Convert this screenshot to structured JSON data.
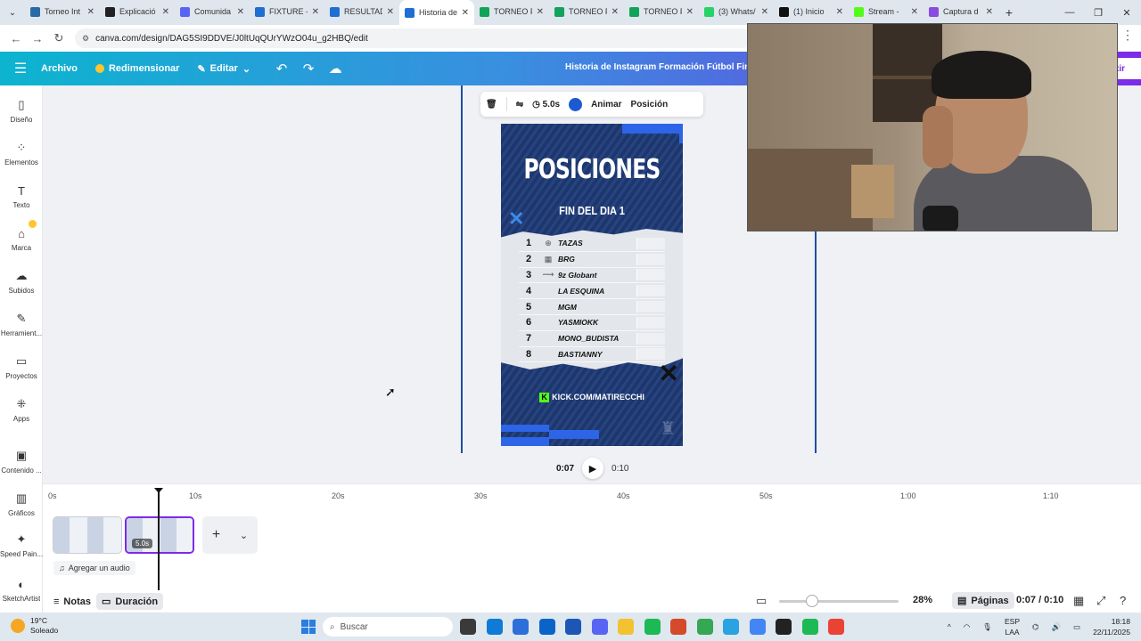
{
  "browser": {
    "tabs": [
      {
        "title": "Torneo Int",
        "color": "#2b6aa8"
      },
      {
        "title": "Explicació",
        "color": "#222"
      },
      {
        "title": "Comunida",
        "color": "#5865f2"
      },
      {
        "title": "FIXTURE -",
        "color": "#1f6fd1"
      },
      {
        "title": "RESULTAD",
        "color": "#1f6fd1"
      },
      {
        "title": "Historia de",
        "color": "#1f6fd1",
        "active": true
      },
      {
        "title": "TORNEO F",
        "color": "#12a35a"
      },
      {
        "title": "TORNEO F",
        "color": "#12a35a"
      },
      {
        "title": "TORNEO F",
        "color": "#12a35a"
      },
      {
        "title": "(3) Whats/",
        "color": "#25d366"
      },
      {
        "title": "(1) Inicio",
        "color": "#111"
      },
      {
        "title": "Stream -",
        "color": "#53fc18"
      },
      {
        "title": "Captura d",
        "color": "#8a4be0"
      }
    ],
    "url": "canva.com/design/DAG5SI9DDVE/J0ltUqQUrYWzO04u_g2HBQ/edit"
  },
  "canva_header": {
    "file_label": "Archivo",
    "resize_label": "Redimensionar",
    "edit_label": "Editar",
    "doc_title": "Historia de Instagram Formación Fútbol Final",
    "share_label": "tir"
  },
  "sidebar": {
    "items": [
      {
        "label": "Diseño",
        "icon": "layout-icon",
        "glyph": "▯"
      },
      {
        "label": "Elementos",
        "icon": "elements-icon",
        "glyph": "⁘"
      },
      {
        "label": "Texto",
        "icon": "text-icon",
        "glyph": "T"
      },
      {
        "label": "Marca",
        "icon": "brand-icon",
        "glyph": "⌂"
      },
      {
        "label": "Subidos",
        "icon": "upload-icon",
        "glyph": "☁"
      },
      {
        "label": "Herramient...",
        "icon": "tools-icon",
        "glyph": "✎"
      },
      {
        "label": "Proyectos",
        "icon": "folder-icon",
        "glyph": "▭"
      },
      {
        "label": "Apps",
        "icon": "apps-icon",
        "glyph": "⁜"
      },
      {
        "label": "Contenido ...",
        "icon": "magic-media-icon",
        "glyph": "▣"
      },
      {
        "label": "Gráficos",
        "icon": "charts-icon",
        "glyph": "▥"
      },
      {
        "label": "Speed Pain...",
        "icon": "speed-paint-icon",
        "glyph": "✦"
      },
      {
        "label": "SketchArtist",
        "icon": "sketch-artist-icon",
        "glyph": "◐"
      }
    ]
  },
  "context_toolbar": {
    "duration": "5.0s",
    "animate_label": "Animar",
    "position_label": "Posición",
    "color": "#1d5ad1"
  },
  "design": {
    "title": "POSICIONES",
    "subtitle": "FIN DEL DIA 1",
    "standings": [
      {
        "pos": "1",
        "team": "TAZAS",
        "logo": "⊕"
      },
      {
        "pos": "2",
        "team": "BRG",
        "logo": "▦"
      },
      {
        "pos": "3",
        "team": "9z Globant",
        "logo": "⟿"
      },
      {
        "pos": "4",
        "team": "LA ESQUINA",
        "logo": ""
      },
      {
        "pos": "5",
        "team": "MGM",
        "logo": ""
      },
      {
        "pos": "6",
        "team": "YASMIOKK",
        "logo": ""
      },
      {
        "pos": "7",
        "team": "MONO_BUDISTA",
        "logo": ""
      },
      {
        "pos": "8",
        "team": "BASTIANNY",
        "logo": ""
      }
    ],
    "footer_link": "KICK.COM/MATIRECCHI",
    "accent": "#2e65e8"
  },
  "playback": {
    "current": "0:07",
    "total": "0:10"
  },
  "timeline": {
    "ticks": [
      "0s",
      "10s",
      "20s",
      "30s",
      "40s",
      "50s",
      "1:00",
      "1:10"
    ],
    "clip2_duration": "5.0s",
    "add_audio_label": "Agregar un audio"
  },
  "bottombar": {
    "notes_label": "Notas",
    "duration_label": "Duración",
    "zoom": "28%",
    "zoom_fraction": 0.28,
    "pages_label": "Páginas",
    "page_time": "0:07 / 0:10"
  },
  "taskbar": {
    "temp": "19°C",
    "weather": "Soleado",
    "search_placeholder": "Buscar",
    "lang1": "ESP",
    "lang2": "LAA",
    "time": "18:18",
    "date": "22/11/2025",
    "apps": [
      {
        "name": "widgets-app",
        "color": "#3a3a3a"
      },
      {
        "name": "edge-app",
        "color": "#0f7bd6"
      },
      {
        "name": "store-app",
        "color": "#2d6fd8"
      },
      {
        "name": "outlook-app",
        "color": "#0a64c8"
      },
      {
        "name": "word-app",
        "color": "#1d56b5"
      },
      {
        "name": "discord-app",
        "color": "#5865f2"
      },
      {
        "name": "files-app",
        "color": "#f2c231"
      },
      {
        "name": "spotify-app",
        "color": "#1db954"
      },
      {
        "name": "office-app",
        "color": "#d44a2a"
      },
      {
        "name": "chrome-app",
        "color": "#34a853"
      },
      {
        "name": "telegram-app",
        "color": "#2aa3e0"
      },
      {
        "name": "chrome-app-2",
        "color": "#4285f4"
      },
      {
        "name": "obs-app",
        "color": "#222"
      },
      {
        "name": "spotify-app-2",
        "color": "#1db954"
      },
      {
        "name": "chrome-app-3",
        "color": "#ea4335"
      }
    ]
  }
}
